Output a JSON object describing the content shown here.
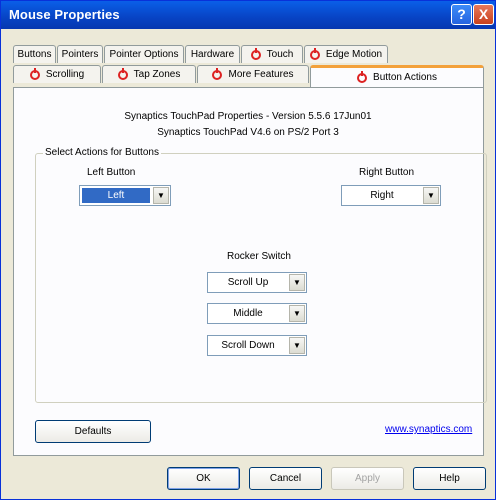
{
  "window": {
    "title": "Mouse Properties",
    "help_glyph": "?",
    "close_glyph": "X"
  },
  "tabs_row1": [
    {
      "label": "Buttons",
      "icon": false
    },
    {
      "label": "Pointers",
      "icon": false
    },
    {
      "label": "Pointer Options",
      "icon": false
    },
    {
      "label": "Hardware",
      "icon": false
    },
    {
      "label": "Touch",
      "icon": true
    },
    {
      "label": "Edge Motion",
      "icon": true
    }
  ],
  "tabs_row2": [
    {
      "label": "Scrolling",
      "icon": true
    },
    {
      "label": "Tap Zones",
      "icon": true
    },
    {
      "label": "More Features",
      "icon": true
    },
    {
      "label": "Button Actions",
      "icon": true,
      "active": true
    }
  ],
  "info": {
    "line1": "Synaptics TouchPad Properties - Version 5.5.6 17Jun01",
    "line2": "Synaptics TouchPad V4.6 on PS/2 Port 3"
  },
  "group": {
    "label": "Select Actions for Buttons"
  },
  "left_button": {
    "label": "Left Button",
    "value": "Left"
  },
  "right_button": {
    "label": "Right Button",
    "value": "Right"
  },
  "rocker": {
    "label": "Rocker Switch",
    "values": [
      "Scroll Up",
      "Middle",
      "Scroll Down"
    ]
  },
  "defaults_label": "Defaults",
  "link_text": "www.synaptics.com",
  "buttons": {
    "ok": "OK",
    "cancel": "Cancel",
    "apply": "Apply",
    "help": "Help"
  },
  "colors": {
    "accent_tab": "#F3A13B",
    "titlebar": "#0743C4",
    "selection": "#316AC5"
  },
  "icons": {
    "tab_icon": "synaptics-logo-icon",
    "dropdown": "chevron-down-icon"
  }
}
